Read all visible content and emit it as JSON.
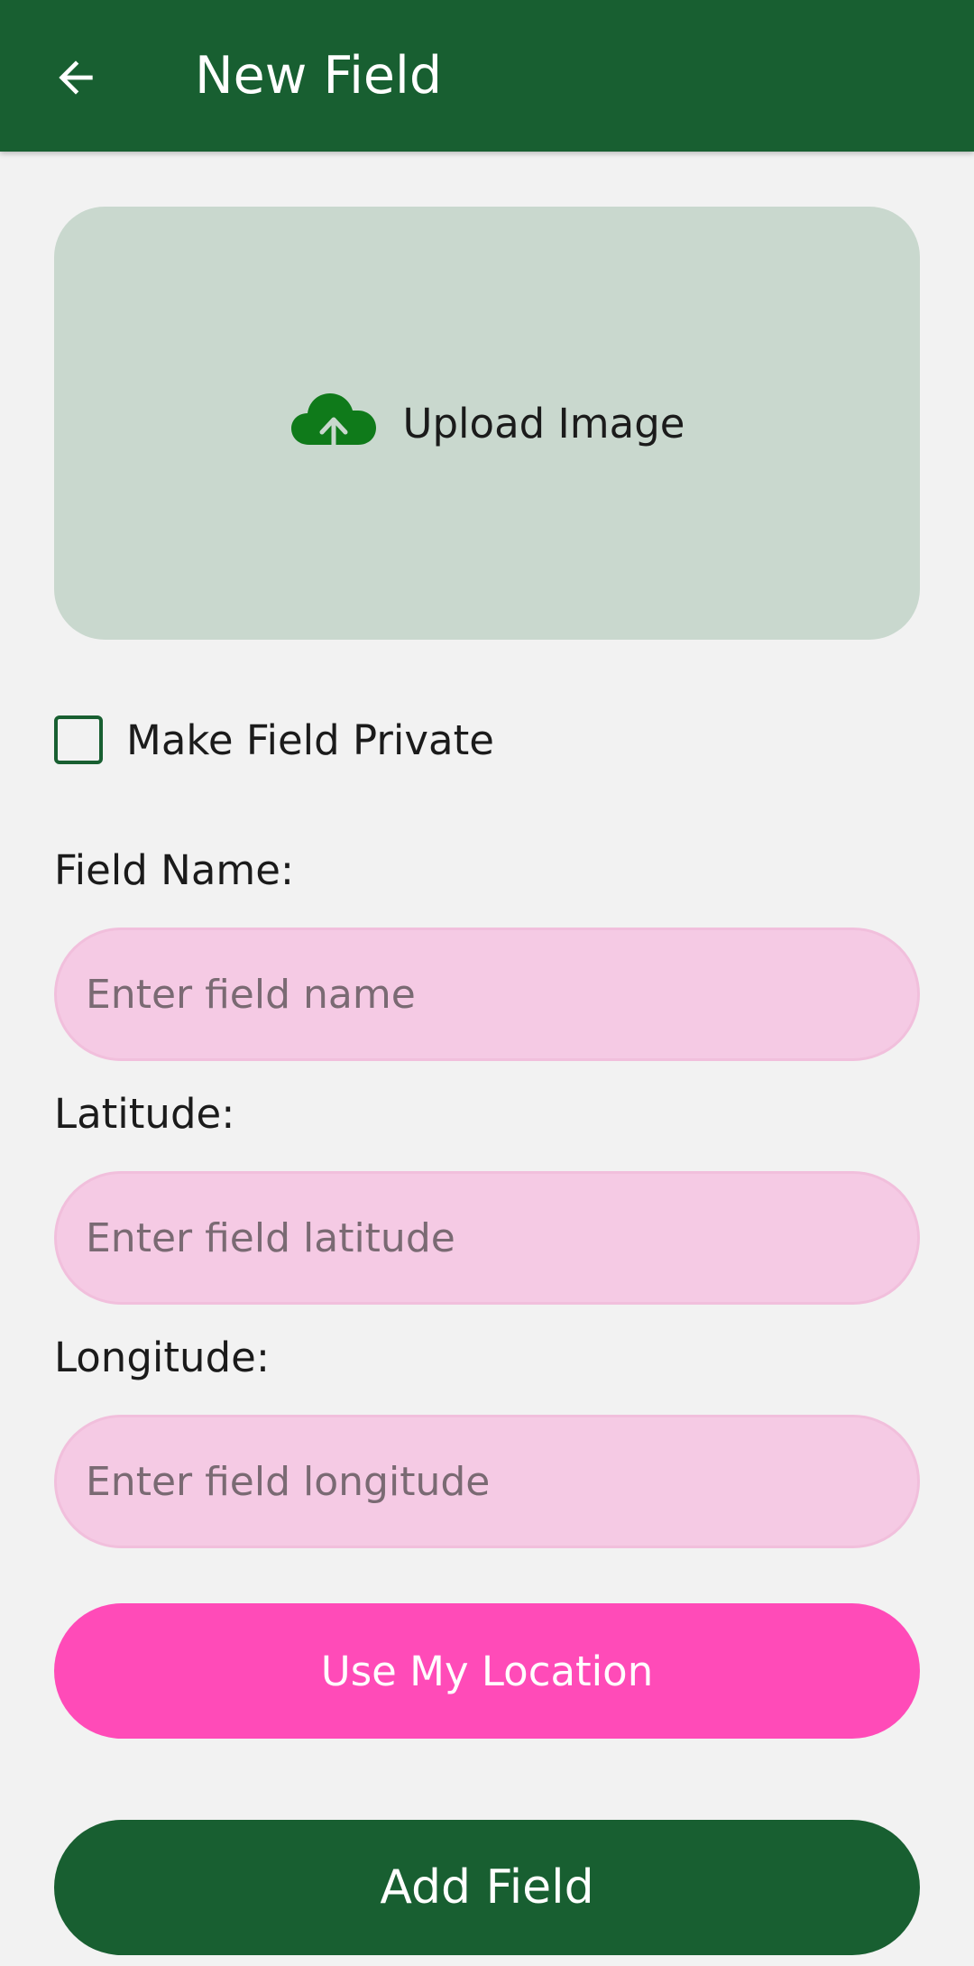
{
  "app_bar": {
    "title": "New Field",
    "back_icon": "arrow-back-icon",
    "color": "#185f31"
  },
  "upload": {
    "label": "Upload Image",
    "icon": "cloud-upload-icon",
    "icon_color": "#0f7a1a"
  },
  "private_toggle": {
    "label": "Make Field Private",
    "checked": false
  },
  "form": {
    "name": {
      "label": "Field Name:",
      "placeholder": "Enter field name",
      "value": ""
    },
    "latitude": {
      "label": "Latitude:",
      "placeholder": "Enter field latitude",
      "value": ""
    },
    "longitude": {
      "label": "Longitude:",
      "placeholder": "Enter field longitude",
      "value": ""
    }
  },
  "buttons": {
    "use_location": "Use My Location",
    "add_field": "Add Field"
  },
  "colors": {
    "primary": "#185f31",
    "accent": "#ff4bb8",
    "input_bg": "#f5cae4",
    "upload_bg": "#c9d8ce"
  }
}
